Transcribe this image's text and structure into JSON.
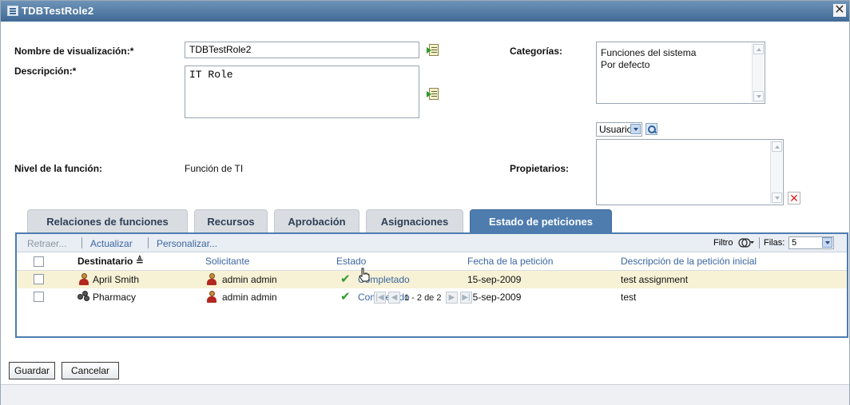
{
  "window": {
    "title": "TDBTestRole2",
    "close_label": "✕"
  },
  "form": {
    "display_name_label": "Nombre de visualización:*",
    "display_name_value": "TDBTestRole2",
    "description_label": "Descripción:*",
    "description_value": "IT Role",
    "categories_label": "Categorías:",
    "categories": [
      "Funciones del sistema",
      "Por defecto"
    ],
    "level_label": "Nivel de la función:",
    "level_value": "Función de TI",
    "owners_label": "Propietarios:",
    "owner_type_selected": "Usuario"
  },
  "tabs": [
    {
      "label": "Relaciones de funciones",
      "active": false
    },
    {
      "label": "Recursos",
      "active": false
    },
    {
      "label": "Aprobación",
      "active": false
    },
    {
      "label": "Asignaciones",
      "active": false
    },
    {
      "label": "Estado de peticiones",
      "active": true
    }
  ],
  "toolbar": {
    "collapse": "Retraer...",
    "refresh": "Actualizar",
    "customize": "Personalizar...",
    "filter": "Filtro",
    "rows_label": "Filas:",
    "rows_value": "5"
  },
  "table": {
    "columns": [
      "Destinatario",
      "Solicitante",
      "Estado",
      "Fecha de la petición",
      "Descripción de la petición inicial"
    ],
    "sort_indicator": "≜",
    "rows": [
      {
        "recipient": "April Smith",
        "requester": "admin admin",
        "status": "Completado",
        "date": "15-sep-2009",
        "description": "test assignment"
      },
      {
        "recipient": "Pharmacy",
        "requester": "admin admin",
        "status": "Completado",
        "date": "15-sep-2009",
        "description": "test"
      }
    ],
    "pager": "1 - 2 de 2"
  },
  "buttons": {
    "save": "Guardar",
    "cancel": "Cancelar"
  },
  "colors": {
    "accent": "#4e7cae",
    "title_bar": "#3f6a95",
    "link": "#3a66a0",
    "check": "#2f9a2f",
    "highlight_row": "#f7f2d6"
  }
}
